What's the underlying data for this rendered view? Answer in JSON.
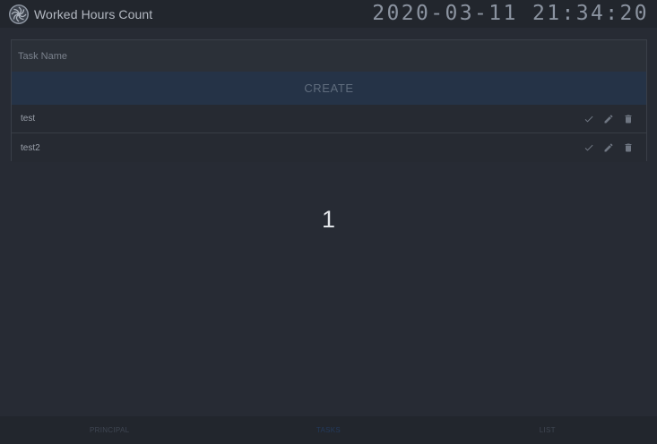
{
  "header": {
    "title": "Worked Hours Count",
    "clock": "2020-03-11 21:34:20"
  },
  "form": {
    "task_placeholder": "Task Name",
    "create_label": "CREATE"
  },
  "tasks": [
    {
      "name": "test"
    },
    {
      "name": "test2"
    }
  ],
  "page_number": "1",
  "bottom_nav": {
    "items": [
      {
        "label": "PRINCIPAL",
        "active": false
      },
      {
        "label": "TASKS",
        "active": true
      },
      {
        "label": "LIST",
        "active": false
      }
    ]
  },
  "icons": {
    "logo": "swirl-logo-icon",
    "complete": "check-icon",
    "edit": "pencil-icon",
    "delete": "trash-icon"
  },
  "colors": {
    "background": "#272b34",
    "header": "#22262d",
    "create_button": "#253347",
    "active_nav": "#243a5c"
  }
}
